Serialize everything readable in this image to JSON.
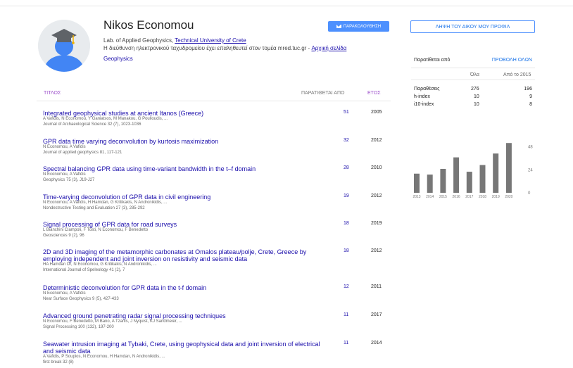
{
  "profile": {
    "name": "Nikos Economou",
    "affiliation_prefix": "Lab. of Applied Geophysics, ",
    "affiliation_link": "Technical University of Crete",
    "email_text": "Η διεύθυνση ηλεκτρονικού ταχυδρομείου έχει επαληθευτεί στον τομέα mred.tuc.gr - ",
    "homepage_link": "Αρχική σελίδα",
    "interest": "Geophysics",
    "follow_label": "ΠΑΡΑΚΟΛΟΥΘΗΣΗ",
    "get_profile_label": "ΛΗΨΗ ΤΟΥ ΔΙΚΟΥ ΜΟΥ ΠΡΟΦΙΛ"
  },
  "table": {
    "col_title": "ΤΙΤΛΟΣ",
    "col_cited": "ΠΑΡΑΤΙΘΕΤΑΙ ΑΠΟ",
    "col_year": "ΕΤΟΣ"
  },
  "articles": [
    {
      "title": "Integrated geophysical studies at ancient Itanos (Greece)",
      "authors": "A Vafidis, N Economou, Y Ganiatsos, M Manakou, G Poulioudis, ...",
      "venue": "Journal of Archaeological Science 32 (7), 1023-1036",
      "cited": "51",
      "year": "2005"
    },
    {
      "title": "GPR data time varying deconvolution by kurtosis maximization",
      "authors": "N Economou, A Vafidis",
      "venue": "Journal of applied geophysics 81, 117-121",
      "cited": "32",
      "year": "2012"
    },
    {
      "title": "Spectral balancing GPR data using time-variant bandwidth in the t–f domain",
      "authors": "N Economou, A Vafidis",
      "venue": "Geophysics 75 (3), J19-J27",
      "cited": "28",
      "year": "2010"
    },
    {
      "title": "Time-varying deconvolution of GPR data in civil engineering",
      "authors": "N Economou, A Vafidis, H Hamdan, G Kritikakis, N Andronikidis, ...",
      "venue": "Nondestructive Testing and Evaluation 27 (3), 285-292",
      "cited": "19",
      "year": "2012"
    },
    {
      "title": "Signal processing of GPR data for road surveys",
      "authors": "L Bianchini Ciampoli, F Tosti, N Economou, F Benedetto",
      "venue": "Geosciences 9 (2), 96",
      "cited": "18",
      "year": "2019"
    },
    {
      "title": "2D and 3D imaging of the metamorphic carbonates at Omalos plateau/polje, Crete, Greece by employing independent and joint inversion on resistivity and seismic data",
      "authors": "HA Hamdan Dr, N Economou, G Kritikakis, N Andronikidis, ...",
      "venue": "International Journal of Speleology 41 (2), 7",
      "cited": "18",
      "year": "2012"
    },
    {
      "title": "Deterministic deconvolution for GPR data in the t-f domain",
      "authors": "N Economou, A Vafidis",
      "venue": "Near Surface Geophysics 9 (5), 427-433",
      "cited": "12",
      "year": "2011"
    },
    {
      "title": "Advanced ground penetrating radar signal processing techniques",
      "authors": "N Economou, F Benedetto, M Bano, A Tzanis, J Nyquist, KJ Sandmeier, ...",
      "venue": "Signal Processing 100 (132), 197-200",
      "cited": "11",
      "year": "2017"
    },
    {
      "title": "Seawater intrusion imaging at Tybaki, Crete, using geophysical data and joint inversion of electrical and seismic data",
      "authors": "A Vafidis, P Soupios, N Economou, H Hamdan, N Andronikidis, ...",
      "venue": "first break 32 (8)",
      "cited": "11",
      "year": "2014"
    }
  ],
  "stats": {
    "header_label": "Παρατίθεται από",
    "view_all": "ΠΡΟΒΟΛΗ ΟΛΩΝ",
    "col_all": "Όλα",
    "col_since": "Από το 2015",
    "rows": [
      {
        "label": "Παραθέσεις",
        "all": "276",
        "since": "196"
      },
      {
        "label": "h-index",
        "all": "10",
        "since": "9"
      },
      {
        "label": "i10-index",
        "all": "10",
        "since": "8"
      }
    ]
  },
  "chart_data": {
    "type": "bar",
    "categories": [
      "2013",
      "2014",
      "2015",
      "2016",
      "2017",
      "2018",
      "2019",
      "2020"
    ],
    "values": [
      20,
      19,
      25,
      37,
      22,
      29,
      41,
      52
    ],
    "ylim": [
      0,
      72
    ],
    "yticks": [
      "48",
      "24",
      "0"
    ],
    "bar_color": "#777777"
  }
}
